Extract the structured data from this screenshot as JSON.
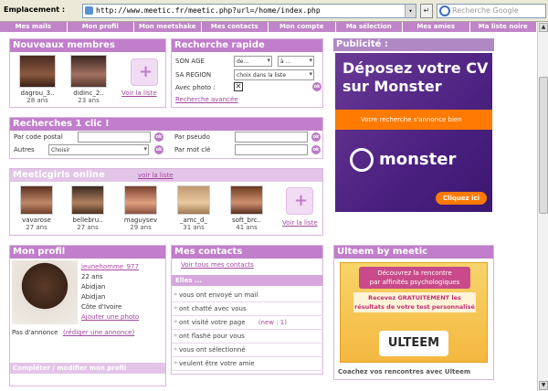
{
  "browser": {
    "location_label": "Emplacement :",
    "url": "http://www.meetic.fr/meetic.php?url=/home/index.php",
    "search_placeholder": "Recherche Google"
  },
  "nav": [
    "Mes mails",
    "Mon profil",
    "Mon meetshake",
    "Mes contacts",
    "Mon compte",
    "Ma sélection",
    "Mes amies",
    "Ma liste noire"
  ],
  "new_members": {
    "title": "Nouveaux membres",
    "items": [
      {
        "name": "dagrou_3..",
        "age": "28 ans"
      },
      {
        "name": "didinc_2..",
        "age": "23 ans"
      }
    ],
    "see_list": "Voir la liste"
  },
  "quick_search": {
    "title": "Recherche rapide",
    "son_age": "SON AGE",
    "age_from": "de...",
    "age_to": "à ...",
    "sa_region": "SA REGION",
    "region_value": "choix dans la liste",
    "photo_label": "Avec photo :",
    "advanced": "Recherche avancée",
    "ok": "ok"
  },
  "one_click": {
    "title": "Recherches 1 clic !",
    "postal": "Par code postal",
    "pseudo": "Par pseudo",
    "others": "Autres",
    "others_value": "Choisir",
    "keyword": "Par mot clé",
    "ok": "ok"
  },
  "meeticgirls": {
    "title": "Meeticgirls online",
    "see_list_top": "voir la liste",
    "items": [
      {
        "name": "vavarose",
        "age": "27 ans"
      },
      {
        "name": "bellebru..",
        "age": "27 ans"
      },
      {
        "name": "maguysev",
        "age": "29 ans"
      },
      {
        "name": "_amc_d_",
        "age": "31 ans"
      },
      {
        "name": "soft_brc..",
        "age": "41 ans"
      }
    ],
    "see_list": "Voir la liste"
  },
  "ad": {
    "title": "Publicité :",
    "headline_1": "Déposez votre CV",
    "headline_2": "sur Monster",
    "tagline": "Votre recherche s'annonce bien",
    "brand": "monster",
    "cta": "Cliquez ici"
  },
  "profile": {
    "title": "Mon profil",
    "username": "jeunehomme_977",
    "age": "22 ans",
    "city": "Abidjan",
    "region": "Abidjan",
    "country": "Côte d'Ivoire",
    "add_photo": "Ajouter une photo",
    "ad_status": "Pas d'annonce",
    "write_ad": "(rédiger une annonce)",
    "complete": "Compléter / modifier mon profil"
  },
  "contacts": {
    "title": "Mes contacts",
    "see_all": "Voir tous mes contacts",
    "elles": "Elles ...",
    "rows": [
      {
        "text": "vous ont envoyé un mail",
        "extra": ""
      },
      {
        "text": "ont chatté avec vous",
        "extra": ""
      },
      {
        "text": "ont visité votre page",
        "extra": "(new : 1)"
      },
      {
        "text": "ont flashé pour vous",
        "extra": ""
      },
      {
        "text": "vous ont sélectionné",
        "extra": ""
      },
      {
        "text": "veulent être votre amie",
        "extra": ""
      }
    ]
  },
  "ulteem": {
    "title": "Ulteem by meetic",
    "line_1": "Découvrez la rencontre",
    "line_2": "par affinités psychologiques",
    "line_3": "Recevez GRATUITEMENT les",
    "line_4": "résultats de votre test personnalisé",
    "logo": "ULTEEM",
    "footer": "Coachez vos rencontres avec Ulteem"
  },
  "colors": {
    "accent": "#c17ecb",
    "ad_purple": "#5a2a86",
    "ad_orange": "#ff7a00"
  }
}
